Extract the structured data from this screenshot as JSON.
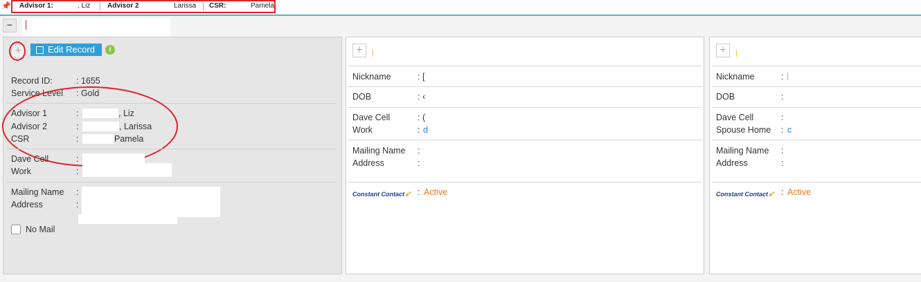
{
  "topbar": {
    "pin_icon": "pin-icon",
    "advisor1_label": "Advisor 1:",
    "advisor1_value": ", Liz",
    "advisor2_label": "Advisor 2",
    "advisor2_value": "Larissa",
    "csr_label": "CSR:",
    "csr_value": "Pamela"
  },
  "toolbar": {
    "collapse_symbol": "−"
  },
  "record": {
    "add_symbol": "+",
    "edit_label": "Edit Record",
    "info_symbol": "i",
    "record_id_label": "Record ID:",
    "record_id_value": ": 1655",
    "service_level_label": "Service Level",
    "service_level_value": ": Gold",
    "advisor1_label": "Advisor 1",
    "advisor1_value": ", Liz",
    "advisor2_label": "Advisor 2",
    "advisor2_value": ", Larissa",
    "csr_label": "CSR",
    "csr_value": "Pamela",
    "dave_cell_label": "Dave Cell",
    "work_label": "Work",
    "mailing_name_label": "Mailing Name",
    "address_label": "Address",
    "no_mail_label": "No Mail",
    "colon": ":"
  },
  "contact1": {
    "add_symbol": "+",
    "nickname_label": "Nickname",
    "nickname_value": ": [",
    "dob_label": "DOB",
    "dob_value": ": ‹",
    "dave_cell_label": "Dave Cell",
    "dave_cell_value": ": (",
    "work_label": "Work",
    "work_value": "d",
    "mailing_name_label": "Mailing Name",
    "address_label": "Address",
    "colon": ":",
    "cc_logo": "Constant Contact",
    "status": "Active"
  },
  "contact2": {
    "add_symbol": "+",
    "nickname_label": "Nickname",
    "dob_label": "DOB",
    "dave_cell_label": "Dave Cell",
    "spouse_home_label": "Spouse Home",
    "spouse_home_value": "c",
    "mailing_name_label": "Mailing Name",
    "address_label": "Address",
    "colon": ":",
    "cc_logo": "Constant Contact",
    "status": "Active"
  },
  "colors": {
    "accent": "#2f9fd8",
    "annotation": "#e0202a",
    "active": "#e87722",
    "topbar_border": "#4fb3c8"
  }
}
